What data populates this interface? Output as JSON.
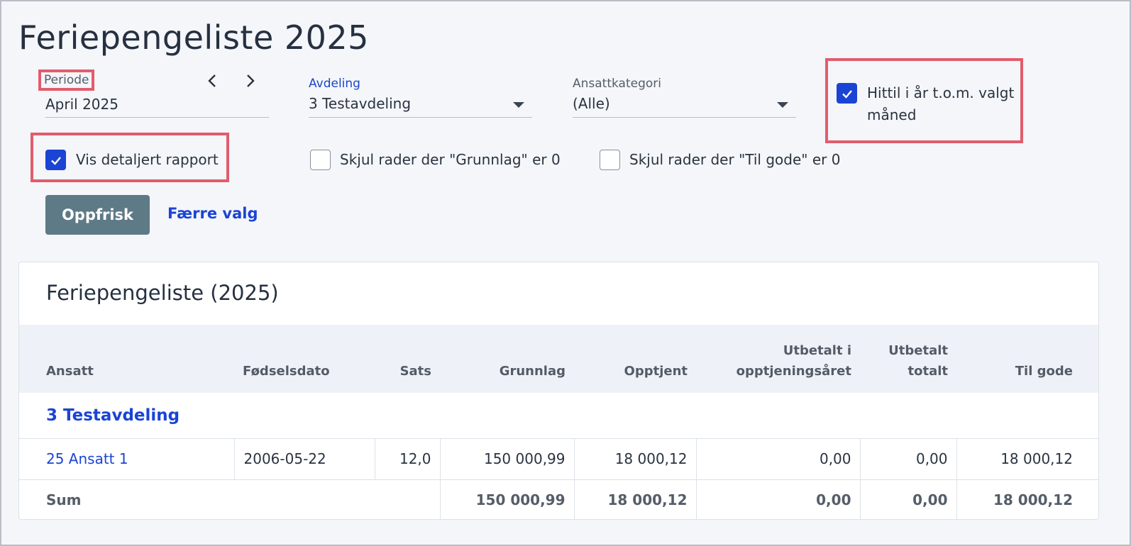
{
  "page": {
    "title": "Feriepengeliste 2025"
  },
  "filters": {
    "periode": {
      "label": "Periode",
      "value": "April 2025",
      "prev_icon": "chevron-left-icon",
      "next_icon": "chevron-right-icon"
    },
    "avdeling": {
      "label": "Avdeling",
      "value": "3 Testavdeling"
    },
    "ansattkategori": {
      "label": "Ansattkategori",
      "value": "(Alle)"
    },
    "hittil": {
      "label_line1": "Hittil i år t.o.m. valgt",
      "label_line2": "måned",
      "checked": true
    },
    "vis_detaljert": {
      "label": "Vis detaljert rapport",
      "checked": true
    },
    "skjul_grunnlag": {
      "label": "Skjul rader der \"Grunnlag\" er 0",
      "checked": false
    },
    "skjul_tilgode": {
      "label": "Skjul rader der \"Til gode\" er 0",
      "checked": false
    }
  },
  "actions": {
    "refresh_label": "Oppfrisk",
    "fewer_options_label": "Færre valg"
  },
  "report": {
    "title": "Feriepengeliste (2025)",
    "columns": {
      "ansatt": "Ansatt",
      "fodselsdato": "Fødselsdato",
      "sats": "Sats",
      "grunnlag": "Grunnlag",
      "opptjent": "Opptjent",
      "utbetalt_i_line1": "Utbetalt i",
      "utbetalt_i_line2": "opptjeningsåret",
      "utbetalt_totalt_line1": "Utbetalt",
      "utbetalt_totalt_line2": "totalt",
      "til_gode": "Til gode"
    },
    "department": "3 Testavdeling",
    "row": {
      "ansatt": "25 Ansatt 1",
      "fodselsdato": "2006-05-22",
      "sats": "12,0",
      "grunnlag": "150 000,99",
      "opptjent": "18 000,12",
      "utbetalt_i": "0,00",
      "utbetalt_totalt": "0,00",
      "til_gode": "18 000,12"
    },
    "sum": {
      "label": "Sum",
      "grunnlag": "150 000,99",
      "opptjent": "18 000,12",
      "utbetalt_i": "0,00",
      "utbetalt_totalt": "0,00",
      "til_gode": "18 000,12"
    }
  },
  "colors": {
    "accent": "#1b44d4",
    "highlight": "#e25c6c",
    "button": "#5d7a86"
  }
}
